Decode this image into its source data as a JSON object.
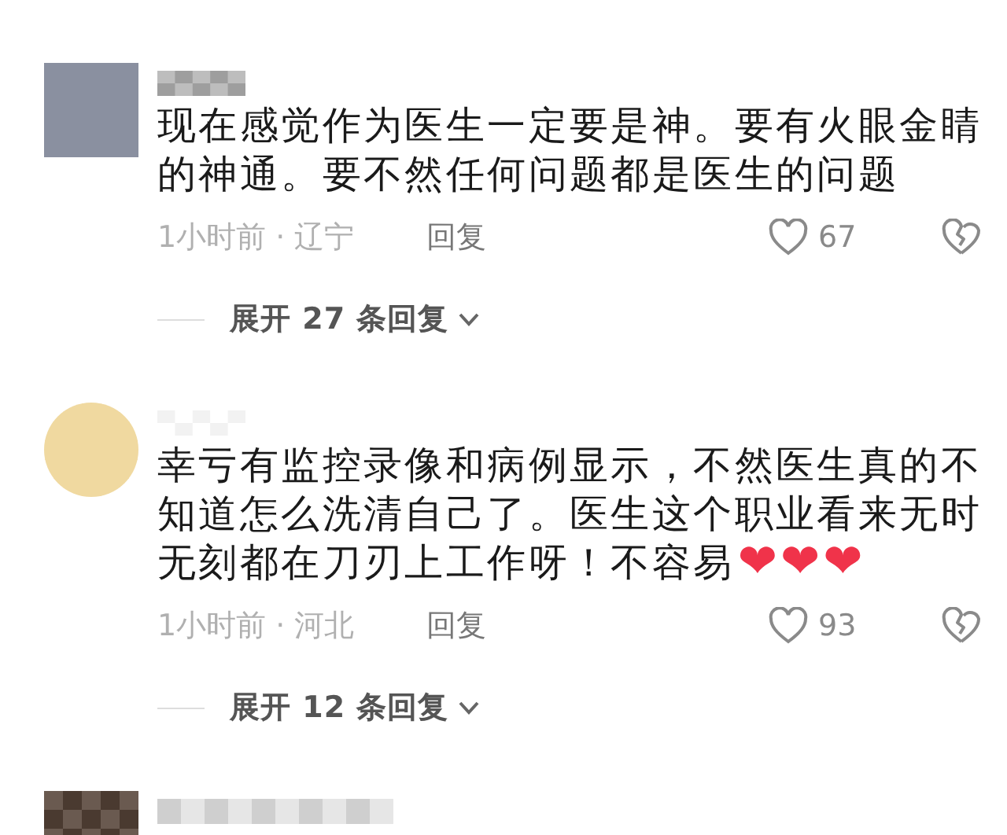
{
  "comments": [
    {
      "avatar": {
        "kind": "picture"
      },
      "username": {
        "kind": "picture"
      },
      "lines": [
        {
          "text": "现在感觉作为医生一定要是神。要有火眼金睛"
        },
        {
          "text": "的神通。要不然任何问题都是医生的问题"
        }
      ],
      "time_location": "1小时前 · 辽宁",
      "reply": "回复",
      "likes": "67",
      "liked": false,
      "replies_toggle": "展开 27 条回复"
    },
    {
      "avatar": {
        "kind": "picture"
      },
      "username": {
        "kind": "picture"
      },
      "lines": [
        {
          "text": "幸亏有监控录像和病例显示，不然医生真的不"
        },
        {
          "text": "知道怎么洗清自己了。医生这个职业看来无时"
        },
        {
          "text": "无刻都在刀刃上工作呀！不容易",
          "emoji": [
            "❤",
            "❤",
            "❤"
          ]
        }
      ],
      "time_location": "1小时前 · 河北",
      "reply": "回复",
      "likes": "93",
      "liked": false,
      "replies_toggle": "展开 12 条回复"
    },
    {
      "avatar": {
        "kind": "picture"
      },
      "username": {
        "kind": "picture"
      }
    }
  ]
}
